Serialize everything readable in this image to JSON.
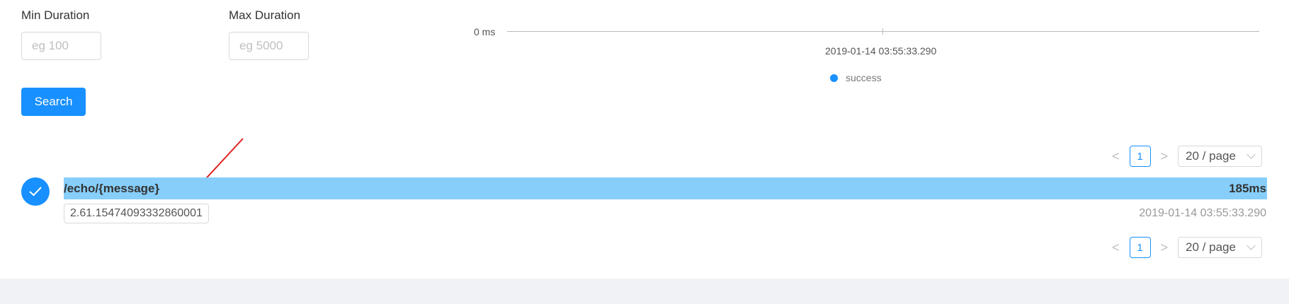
{
  "filters": {
    "min_duration_label": "Min Duration",
    "min_duration_placeholder": "eg 100",
    "max_duration_label": "Max Duration",
    "max_duration_placeholder": "eg 5000",
    "search_label": "Search"
  },
  "chart": {
    "y_label": "0 ms",
    "x_tick": "2019-01-14 03:55:33.290",
    "legend": "success"
  },
  "pagination": {
    "prev": "<",
    "current_page": "1",
    "next": ">",
    "page_size": "20 / page"
  },
  "trace": {
    "endpoint": "/echo/{message}",
    "duration": "185ms",
    "trace_id": "2.61.15474093332860001",
    "time": "2019-01-14 03:55:33.290"
  },
  "colors": {
    "primary": "#1890ff",
    "trace_bar": "#87cefa",
    "annotation_arrow": "#e02020"
  }
}
